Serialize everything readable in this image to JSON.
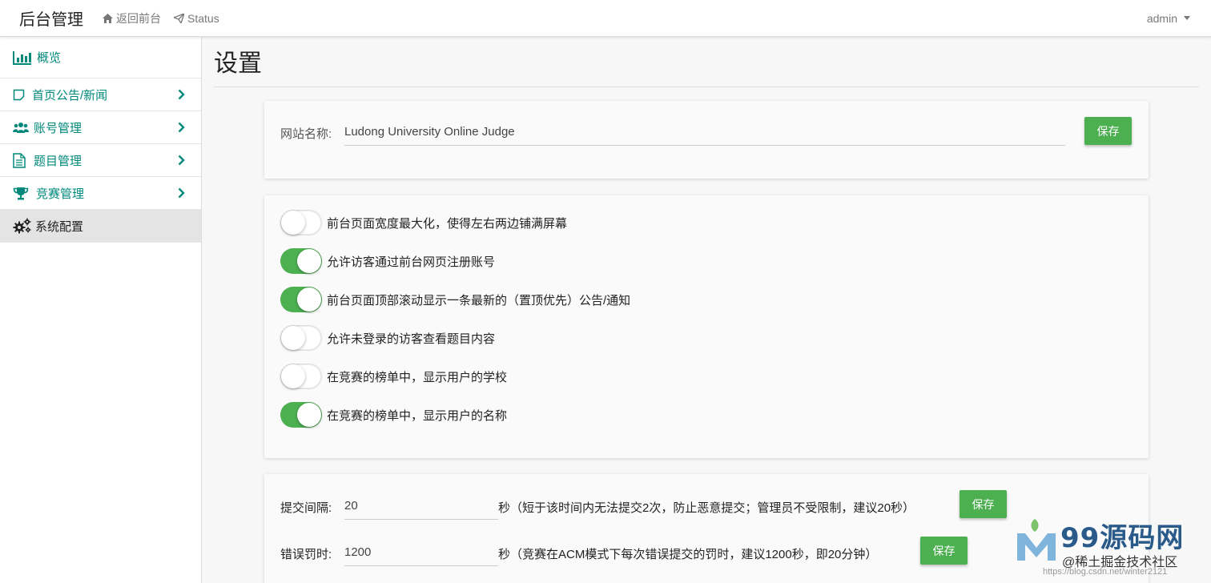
{
  "navbar": {
    "brand": "后台管理",
    "back_link": "返回前台",
    "status_link": "Status",
    "user": "admin"
  },
  "sidebar": {
    "items": [
      {
        "label": "概览",
        "icon": "bar-chart-icon"
      },
      {
        "label": "首页公告/新闻",
        "icon": "note-icon"
      },
      {
        "label": "账号管理",
        "icon": "users-icon"
      },
      {
        "label": "题目管理",
        "icon": "document-icon"
      },
      {
        "label": "竞赛管理",
        "icon": "trophy-icon"
      },
      {
        "label": "系统配置",
        "icon": "gears-icon"
      }
    ]
  },
  "page": {
    "title": "设置"
  },
  "site_name": {
    "label": "网站名称:",
    "value": "Ludong University Online Judge",
    "save_label": "保存"
  },
  "toggles": [
    {
      "label": "前台页面宽度最大化，使得左右两边铺满屏幕",
      "on": false
    },
    {
      "label": "允许访客通过前台网页注册账号",
      "on": true
    },
    {
      "label": "前台页面顶部滚动显示一条最新的（置顶优先）公告/通知",
      "on": true
    },
    {
      "label": "允许未登录的访客查看题目内容",
      "on": false
    },
    {
      "label": "在竞赛的榜单中，显示用户的学校",
      "on": false
    },
    {
      "label": "在竞赛的榜单中，显示用户的名称",
      "on": true
    }
  ],
  "submit_interval": {
    "label": "提交间隔:",
    "value": "20",
    "note": "秒（短于该时间内无法提交2次，防止恶意提交；管理员不受限制，建议20秒）",
    "save_label": "保存"
  },
  "penalty": {
    "label": "错误罚时:",
    "value": "1200",
    "note": "秒（竞赛在ACM模式下每次错误提交的罚时，建议1200秒，即20分钟）",
    "save_label": "保存"
  },
  "watermark": {
    "big": "99源码网",
    "small": "@稀土掘金技术社区",
    "url": "https://blog.csdn.net/winter2121"
  },
  "colors": {
    "accent": "#00897b",
    "success": "#4caf50",
    "active_bg": "#e4e4e4"
  }
}
